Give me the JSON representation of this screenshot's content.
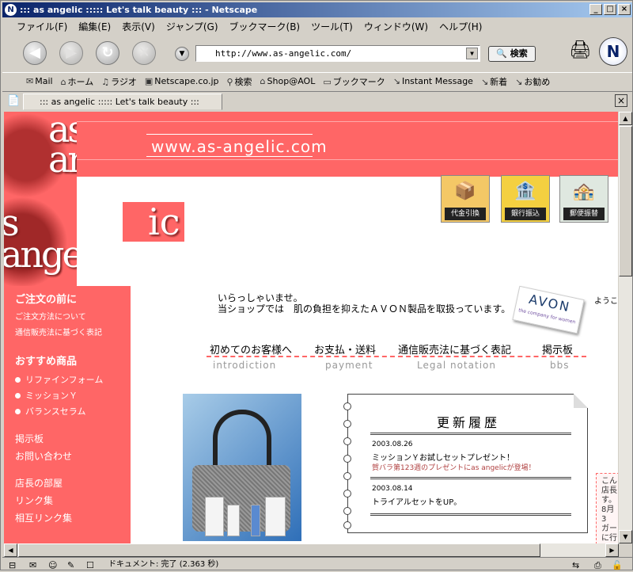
{
  "window": {
    "title": "::: as angelic ::::: Let's talk beauty ::: - Netscape"
  },
  "menu": [
    "ファイル(F)",
    "編集(E)",
    "表示(V)",
    "ジャンプ(G)",
    "ブックマーク(B)",
    "ツール(T)",
    "ウィンドウ(W)",
    "ヘルプ(H)"
  ],
  "nav": {
    "url": "http://www.as-angelic.com/",
    "search_label": "検索"
  },
  "personal_toolbar": [
    {
      "icon": "mail-icon",
      "label": "Mail"
    },
    {
      "icon": "home-icon",
      "label": "ホーム"
    },
    {
      "icon": "radio-icon",
      "label": "ラジオ"
    },
    {
      "icon": "my-icon",
      "label": "Netscape.co.jp"
    },
    {
      "icon": "search-icon",
      "label": "検索"
    },
    {
      "icon": "shop-icon",
      "label": "Shop@AOL"
    },
    {
      "icon": "folder-icon",
      "label": "ブックマーク"
    },
    {
      "icon": "bookmark-icon",
      "label": "Instant Message"
    },
    {
      "icon": "bookmark-icon",
      "label": "新着"
    },
    {
      "icon": "bookmark-icon",
      "label": "お勧め"
    }
  ],
  "tab": {
    "title": "::: as angelic ::::: Let's talk beauty :::"
  },
  "status": {
    "text": "ドキュメント: 完了 (2.363 秒)"
  },
  "site": {
    "url_banner": "www.as-angelic.com",
    "logo": {
      "line1": "as",
      "line2": "ar",
      "line3": "s",
      "line4": "angel",
      "ic": "ic"
    },
    "payments": [
      {
        "label": "代金引換",
        "icon": "cash-on-delivery-icon",
        "bg": "#f4c866"
      },
      {
        "label": "銀行振込",
        "icon": "bank-icon",
        "bg": "#f4d040"
      },
      {
        "label": "郵便振替",
        "icon": "post-office-icon",
        "bg": "#dfe8e0"
      }
    ],
    "sidebar": {
      "heading1": "ご注文の前に",
      "sub1": "ご注文方法について",
      "sub2": "通信販売法に基づく表記",
      "heading2": "おすすめ商品",
      "products": [
        "リファインフォーム",
        "ミッションＹ",
        "バランスセラム"
      ],
      "links": [
        "掲示板",
        "お問い合わせ",
        "店長の部屋",
        "リンク集",
        "相互リンク集"
      ]
    },
    "welcome": {
      "line1": "いらっしゃいませ。",
      "line2": "当ショップでは　肌の負担を抑えたＡＶＯＮ製品を取扱っています。"
    },
    "avon": {
      "brand": "AVON",
      "tagline": "the company for women"
    },
    "youkoso": "ようこ",
    "navlinks": [
      {
        "label": "初めてのお客様へ",
        "sub": "introdiction"
      },
      {
        "label": "お支払・送料",
        "sub": "payment"
      },
      {
        "label": "通信販売法に基づく表記",
        "sub": "Legal notation"
      },
      {
        "label": "掲示板",
        "sub": "bbs"
      }
    ],
    "updates": {
      "title": "更新履歴",
      "entries": [
        {
          "date": "2003.08.26",
          "text": "ミッションＹお試しセットプレゼント！",
          "sub": "賀バラ第123週のプレゼントにas angelicが登場！"
        },
        {
          "date": "2003.08.14",
          "text": "トライアルセットをUP。",
          "sub": ""
        }
      ]
    },
    "right_note": [
      "こん",
      "店長",
      "す。",
      "8月3",
      "ガー",
      "に行"
    ]
  },
  "colors": {
    "brand_red": "#ff6666",
    "title_blue": "#0a246a"
  }
}
